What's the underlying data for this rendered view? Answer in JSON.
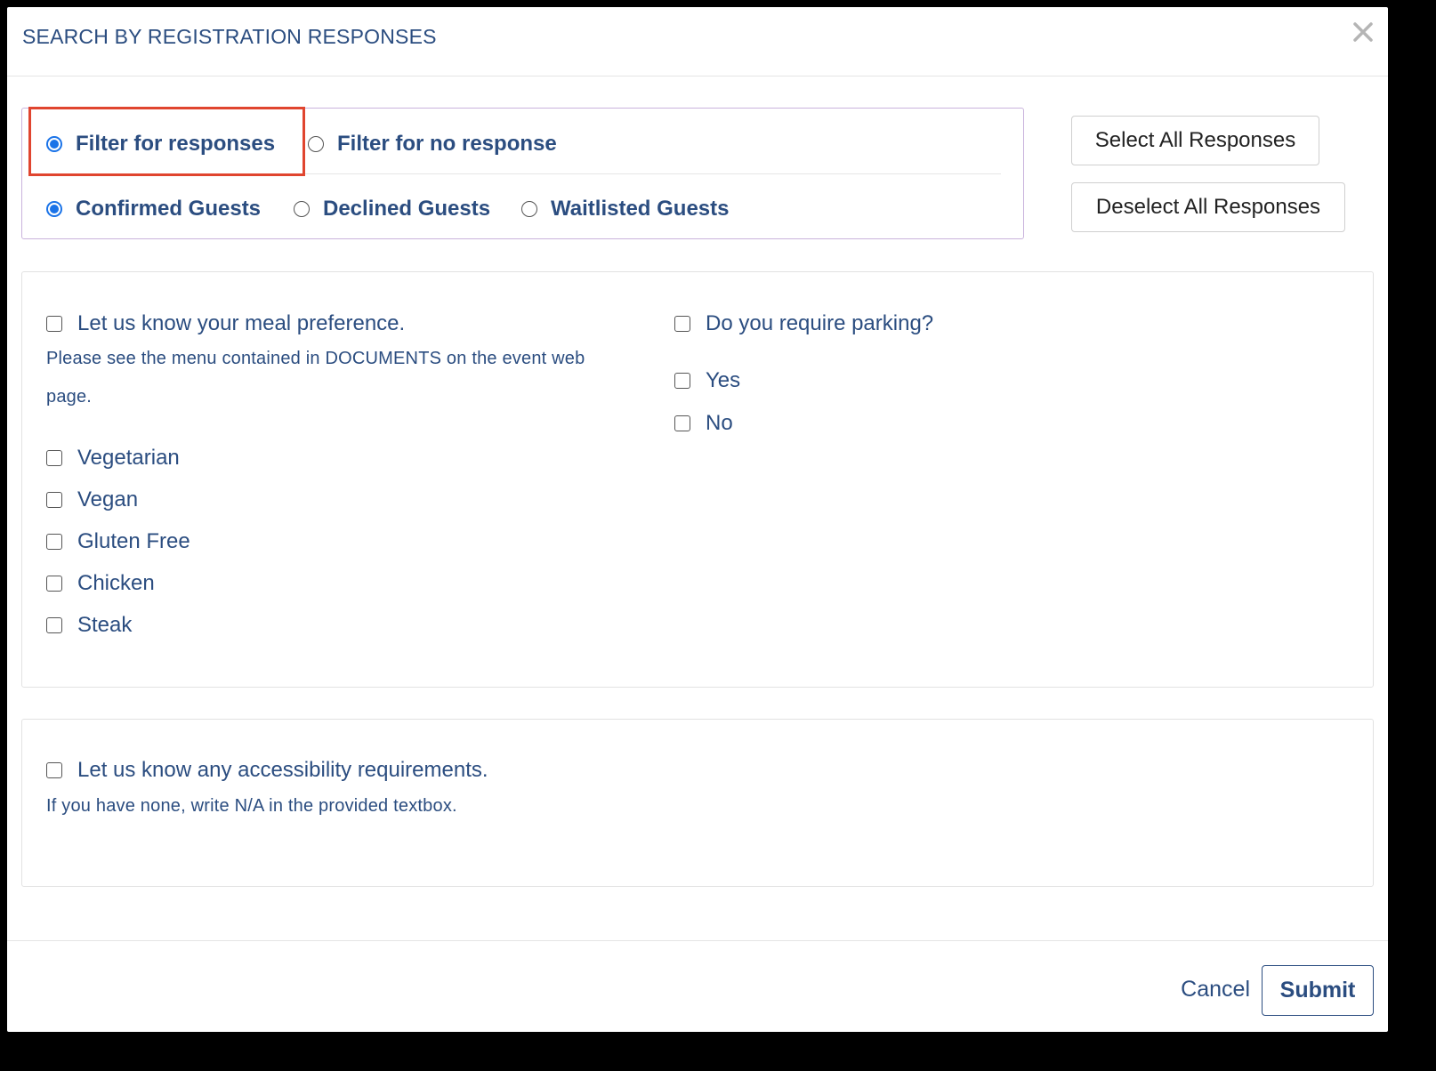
{
  "modal": {
    "title": "SEARCH BY REGISTRATION RESPONSES"
  },
  "filter_mode": {
    "options": [
      {
        "label": "Filter for responses",
        "checked": true
      },
      {
        "label": "Filter for no response",
        "checked": false
      }
    ]
  },
  "guest_status": {
    "options": [
      {
        "label": "Confirmed Guests",
        "checked": true
      },
      {
        "label": "Declined Guests",
        "checked": false
      },
      {
        "label": "Waitlisted Guests",
        "checked": false
      }
    ]
  },
  "actions": {
    "select_all": "Select All Responses",
    "deselect_all": "Deselect All Responses"
  },
  "questions": {
    "meal": {
      "label": "Let us know your meal preference.",
      "help": "Please see the menu contained in DOCUMENTS on the event web page.",
      "choices": [
        "Vegetarian",
        "Vegan",
        "Gluten Free",
        "Chicken",
        "Steak"
      ]
    },
    "parking": {
      "label": "Do you require parking?",
      "choices": [
        "Yes",
        "No"
      ]
    },
    "accessibility": {
      "label": "Let us know any accessibility requirements.",
      "help": "If you have none, write N/A in the provided textbox."
    }
  },
  "footer": {
    "cancel": "Cancel",
    "submit": "Submit"
  },
  "colors": {
    "text": "#2b4d80",
    "radio_accent": "#1a73e8",
    "highlight": "#e0452f",
    "filter_border": "#c9b3dc"
  },
  "icons": {
    "close": "close-icon"
  }
}
